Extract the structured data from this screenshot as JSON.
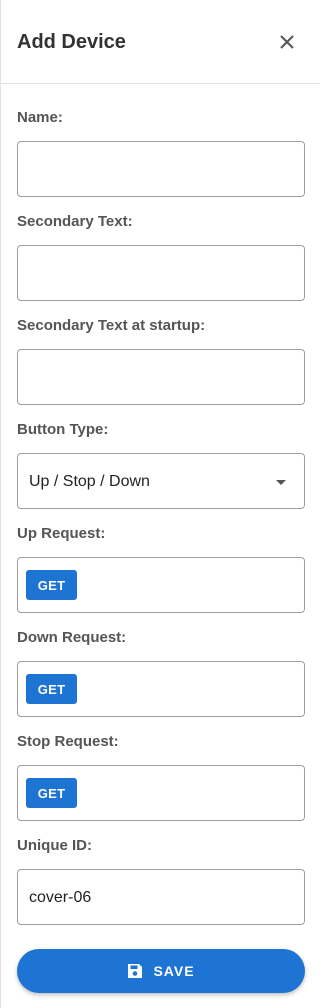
{
  "dialog": {
    "title": "Add Device"
  },
  "fields": {
    "name": {
      "label": "Name:",
      "value": ""
    },
    "secondary_text": {
      "label": "Secondary Text:",
      "value": ""
    },
    "secondary_text_startup": {
      "label": "Secondary Text at startup:",
      "value": ""
    },
    "button_type": {
      "label": "Button Type:",
      "value": "Up / Stop / Down"
    },
    "up_request": {
      "label": "Up Request:",
      "method": "GET"
    },
    "down_request": {
      "label": "Down Request:",
      "method": "GET"
    },
    "stop_request": {
      "label": "Stop Request:",
      "method": "GET"
    },
    "unique_id": {
      "label": "Unique ID:",
      "value": "cover-06"
    }
  },
  "actions": {
    "save_label": "SAVE"
  },
  "icons": {
    "close": "close-icon",
    "dropdown": "chevron-down-icon",
    "save": "floppy-disk-icon"
  },
  "colors": {
    "accent": "#1e74d2",
    "border": "#9e9e9e",
    "label": "#555555"
  }
}
